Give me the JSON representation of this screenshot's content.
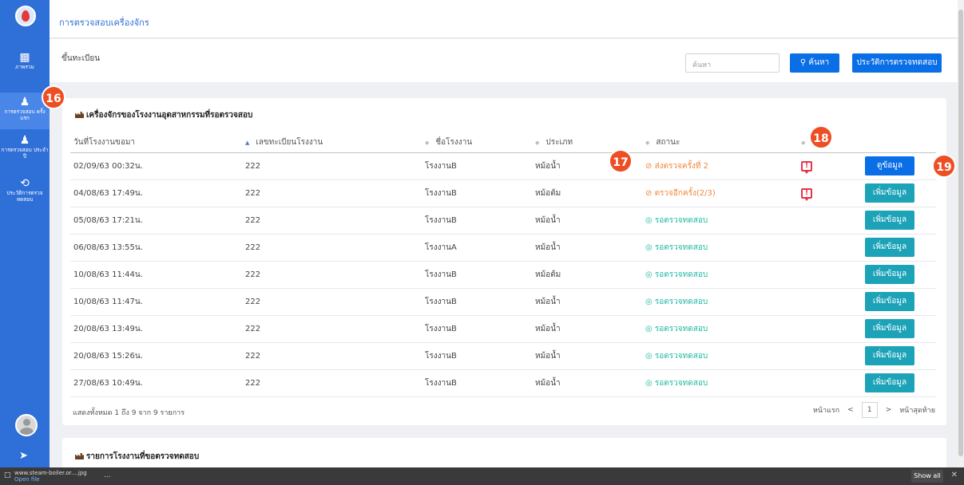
{
  "sidebar": {
    "items": [
      {
        "label": "ภาพรวม",
        "icon": "monitor-icon"
      },
      {
        "label": "การตรวจสอบ ครั้งแรก",
        "icon": "user-icon"
      },
      {
        "label": "การตรวจสอบ ประจำปี",
        "icon": "user-icon"
      },
      {
        "label": "ประวัติการตรวจ ทดสอบ",
        "icon": "history-icon"
      }
    ]
  },
  "header": {
    "title": "การตรวจสอบเครื่องจักร"
  },
  "subbar": {
    "breadcrumb": "ขึ้นทะเบียน",
    "search_placeholder": "ค้นหา",
    "search_button": "ค้นหา",
    "history_button": "ประวัติการตรวจทดสอบ"
  },
  "panel1": {
    "title": "เครื่องจักรของโรงงานอุตสาหกรรมที่รอตรวจสอบ",
    "columns": [
      "วันที่โรงงานขอมา",
      "เลขทะเบียนโรงงาน",
      "ชื่อโรงงาน",
      "ประเภท",
      "สถานะ",
      "",
      ""
    ],
    "rows": [
      {
        "date": "02/09/63 00:32น.",
        "reg": "222",
        "factory": "โรงงานB",
        "type": "หม้อน้ำ",
        "status": "ส่งตรวจครั้งที่ 2",
        "status_color": "#f0883a",
        "alert": true,
        "action": "ดูข้อมูล"
      },
      {
        "date": "04/08/63 17:49น.",
        "reg": "222",
        "factory": "โรงงานB",
        "type": "หม้อต้ม",
        "status": "ตรวจอีกครั้ง(2/3)",
        "status_color": "#f0883a",
        "alert": true,
        "action": "เพิ่มข้อมูล"
      },
      {
        "date": "05/08/63 17:21น.",
        "reg": "222",
        "factory": "โรงงานB",
        "type": "หม้อน้ำ",
        "status": "รอตรวจทดสอบ",
        "status_color": "#20b9a2",
        "alert": false,
        "action": "เพิ่มข้อมูล"
      },
      {
        "date": "06/08/63 13:55น.",
        "reg": "222",
        "factory": "โรงงานA",
        "type": "หม้อน้ำ",
        "status": "รอตรวจทดสอบ",
        "status_color": "#20b9a2",
        "alert": false,
        "action": "เพิ่มข้อมูล"
      },
      {
        "date": "10/08/63 11:44น.",
        "reg": "222",
        "factory": "โรงงานB",
        "type": "หม้อต้ม",
        "status": "รอตรวจทดสอบ",
        "status_color": "#20b9a2",
        "alert": false,
        "action": "เพิ่มข้อมูล"
      },
      {
        "date": "10/08/63 11:47น.",
        "reg": "222",
        "factory": "โรงงานB",
        "type": "หม้อน้ำ",
        "status": "รอตรวจทดสอบ",
        "status_color": "#20b9a2",
        "alert": false,
        "action": "เพิ่มข้อมูล"
      },
      {
        "date": "20/08/63 13:49น.",
        "reg": "222",
        "factory": "โรงงานB",
        "type": "หม้อน้ำ",
        "status": "รอตรวจทดสอบ",
        "status_color": "#20b9a2",
        "alert": false,
        "action": "เพิ่มข้อมูล"
      },
      {
        "date": "20/08/63 15:26น.",
        "reg": "222",
        "factory": "โรงงานB",
        "type": "หม้อน้ำ",
        "status": "รอตรวจทดสอบ",
        "status_color": "#20b9a2",
        "alert": false,
        "action": "เพิ่มข้อมูล"
      },
      {
        "date": "27/08/63 10:49น.",
        "reg": "222",
        "factory": "โรงงานB",
        "type": "หม้อน้ำ",
        "status": "รอตรวจทดสอบ",
        "status_color": "#20b9a2",
        "alert": false,
        "action": "เพิ่มข้อมูล"
      }
    ],
    "pager_info": "แสดงทั้งหมด 1 ถึง 9 จาก 9 รายการ",
    "pager": {
      "first": "หน้าแรก",
      "prev": "<",
      "page": "1",
      "next": ">",
      "last": "หน้าสุดท้าย"
    }
  },
  "panel2": {
    "title": "รายการโรงงานที่ขอตรวจทดสอบ"
  },
  "badges": [
    "16",
    "17",
    "18",
    "19"
  ],
  "download": {
    "file": "www.steam-boiler.or....jpg",
    "sub": "Open file",
    "ellipsis": "...",
    "show_all": "Show all",
    "close": "✕"
  },
  "colors": {
    "sidebar": "#2f6fd8",
    "primary_button": "#0a6fe6",
    "add_button": "#1da3b8",
    "badge": "#ee4e23"
  }
}
